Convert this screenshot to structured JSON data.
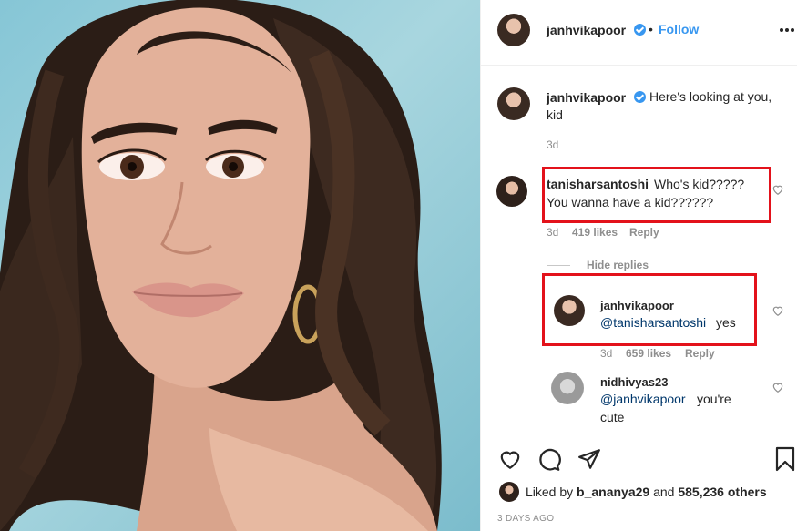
{
  "post_header": {
    "username": "janhvikapoor",
    "separator": "•",
    "follow_label": "Follow",
    "more_icon": "more-options-icon"
  },
  "caption": {
    "username": "janhvikapoor",
    "text": "Here's looking at you, kid",
    "age": "3d"
  },
  "comments": [
    {
      "username": "tanisharsantoshi",
      "text_line1": "Who's kid?????",
      "text_line2": "You wanna have a kid??????",
      "age": "3d",
      "likes": "419 likes",
      "reply": "Reply",
      "hide_replies": "Hide replies",
      "replies": [
        {
          "username": "janhvikapoor",
          "mention": "@tanisharsantoshi",
          "text": "yes",
          "age": "3d",
          "likes": "659 likes",
          "reply": "Reply"
        }
      ]
    },
    {
      "username": "nidhivyas23",
      "mention": "@janhvikapoor",
      "text_line1": "you're",
      "text_line2": "cute"
    }
  ],
  "likes_line": {
    "prefix": "Liked by",
    "user": "b_ananya29",
    "middle": "and",
    "count": "585,236 others"
  },
  "timestamp": "3 DAYS AGO",
  "colors": {
    "accent": "#3897f0",
    "highlight": "#e3121b",
    "text": "#262626",
    "muted": "#8e8e8e",
    "mention": "#00376b"
  }
}
